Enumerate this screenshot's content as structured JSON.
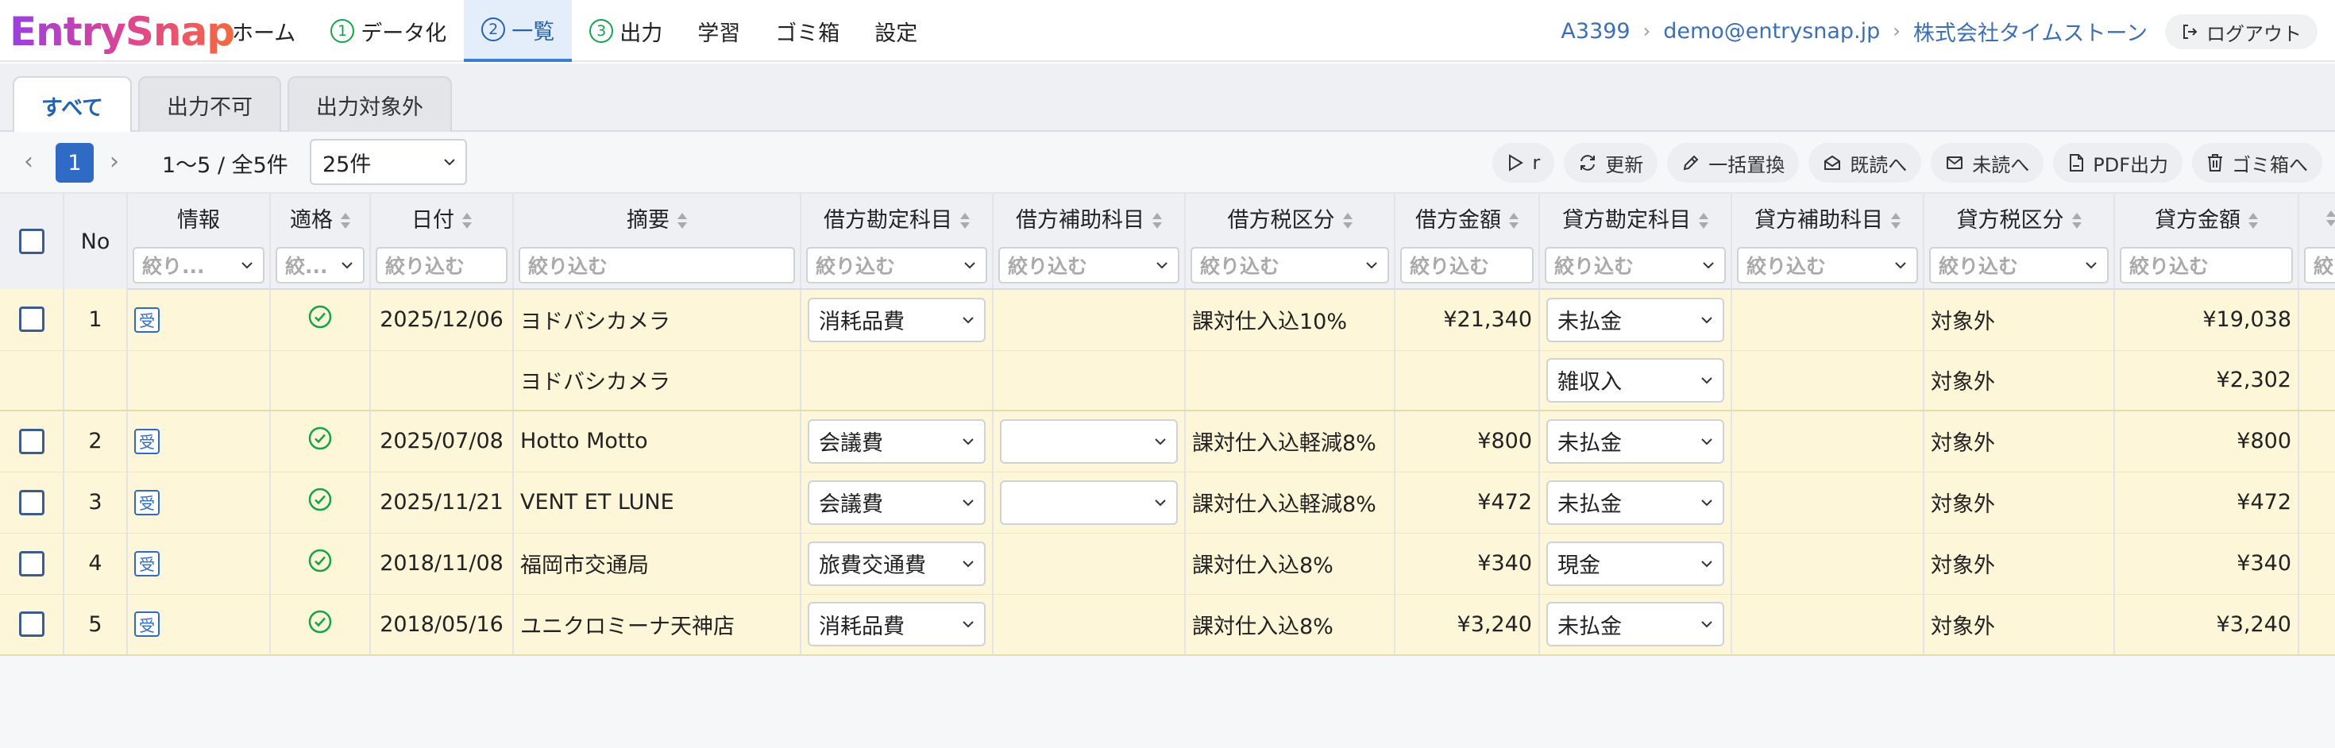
{
  "app": {
    "logo": "EntrySnap"
  },
  "nav": [
    {
      "num": "",
      "label": "ホーム"
    },
    {
      "num": "1",
      "label": "データ化"
    },
    {
      "num": "2",
      "label": "一覧"
    },
    {
      "num": "3",
      "label": "出力"
    },
    {
      "num": "",
      "label": "学習"
    },
    {
      "num": "",
      "label": "ゴミ箱"
    },
    {
      "num": "",
      "label": "設定"
    }
  ],
  "breadcrumb": {
    "code": "A3399",
    "email": "demo@entrysnap.jp",
    "company": "株式会社タイムストーン"
  },
  "logout_label": "ログアウト",
  "tabs": [
    "すべて",
    "出力不可",
    "出力対象外"
  ],
  "pagination": {
    "prev": "‹",
    "current": "1",
    "next": "›",
    "range": "1〜5 / 全5件",
    "per_page": "25件"
  },
  "actions": [
    "r",
    "更新",
    "一括置換",
    "既読へ",
    "未読へ",
    "PDF出力",
    "ゴミ箱へ"
  ],
  "columns": {
    "no": "No",
    "info": "情報",
    "fit": "適格",
    "date": "日付",
    "summary": "摘要",
    "debit_account": "借方勘定科目",
    "debit_sub": "借方補助科目",
    "debit_tax": "借方税区分",
    "debit_amount": "借方金額",
    "credit_account": "貸方勘定科目",
    "credit_sub": "貸方補助科目",
    "credit_tax": "貸方税区分",
    "credit_amount": "貸方金額"
  },
  "filters": {
    "info": "絞り...",
    "fit": "絞...",
    "placeholder": "絞り込む",
    "last": "絞り"
  },
  "rows": [
    {
      "no": "1",
      "badge": "受",
      "date": "2025/12/06",
      "summary": "ヨドバシカメラ",
      "debit_account": "消耗品費",
      "debit_sub": null,
      "debit_tax": "課対仕入込10%",
      "debit_amount": "¥21,340",
      "credit_account": "未払金",
      "credit_tax": "対象外",
      "credit_amount": "¥19,038"
    },
    {
      "sub": true,
      "summary": "ヨドバシカメラ",
      "credit_account": "雑収入",
      "credit_tax": "対象外",
      "credit_amount": "¥2,302"
    },
    {
      "no": "2",
      "badge": "受",
      "date": "2025/07/08",
      "summary": "Hotto Motto",
      "debit_account": "会議費",
      "debit_sub": "",
      "debit_tax": "課対仕入込軽減8%",
      "debit_amount": "¥800",
      "credit_account": "未払金",
      "credit_tax": "対象外",
      "credit_amount": "¥800"
    },
    {
      "no": "3",
      "badge": "受",
      "date": "2025/11/21",
      "summary": "VENT ET LUNE",
      "debit_account": "会議費",
      "debit_sub": "",
      "debit_tax": "課対仕入込軽減8%",
      "debit_amount": "¥472",
      "credit_account": "未払金",
      "credit_tax": "対象外",
      "credit_amount": "¥472"
    },
    {
      "no": "4",
      "badge": "受",
      "date": "2018/11/08",
      "summary": "福岡市交通局",
      "debit_account": "旅費交通費",
      "debit_sub": null,
      "debit_tax": "課対仕入込8%",
      "debit_amount": "¥340",
      "credit_account": "現金",
      "credit_tax": "対象外",
      "credit_amount": "¥340"
    },
    {
      "no": "5",
      "badge": "受",
      "date": "2018/05/16",
      "summary": "ユニクロミーナ天神店",
      "debit_account": "消耗品費",
      "debit_sub": null,
      "debit_tax": "課対仕入込8%",
      "debit_amount": "¥3,240",
      "credit_account": "未払金",
      "credit_tax": "対象外",
      "credit_amount": "¥3,240"
    }
  ]
}
